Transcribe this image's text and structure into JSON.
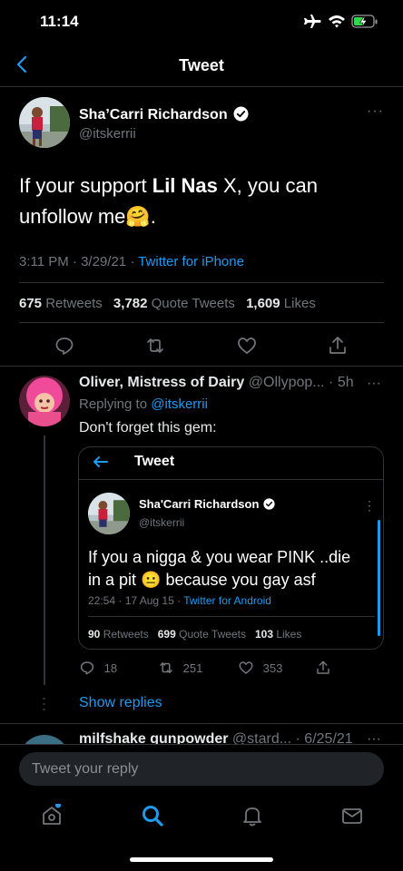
{
  "status_bar": {
    "time": "11:14"
  },
  "nav": {
    "title": "Tweet"
  },
  "tweet": {
    "name": "Sha’Carri Richardson",
    "handle": "@itskerrii",
    "more": "···",
    "text_prefix": "If your support ",
    "text_bold": "Lil Nas",
    "text_suffix": " X, you can unfollow me",
    "emoji": "🤗",
    "period": ".",
    "time": "3:11 PM",
    "date": "3/29/21",
    "sep": "·",
    "source": "Twitter for iPhone",
    "retweets": "675",
    "retweets_label": "Retweets",
    "quotes": "3,782",
    "quotes_label": "Quote Tweets",
    "likes": "1,609",
    "likes_label": "Likes"
  },
  "reply": {
    "name": "Oliver, Mistress of Dairy",
    "handle": "@Ollypop...",
    "age": "· 5h",
    "more": "···",
    "replying_prefix": "Replying to ",
    "replying_handle": "@itskerrii",
    "text": "Don't forget this gem:",
    "replies": "18",
    "retweets": "251",
    "likes": "353"
  },
  "quote": {
    "header": "Tweet",
    "name": "Sha'Carri Richardson",
    "handle": "@itskerrii",
    "more": "⋮",
    "text_line1": "If you a nigga & you wear PINK ..die",
    "text_line2_a": "in a pit ",
    "emoji": "😐",
    "text_line2_b": " because you gay asf",
    "meta": "22:54 · 17 Aug 15 · ",
    "source": "Twitter for Android",
    "retweets": "90",
    "retweets_label": "Retweets",
    "quotes": "699",
    "quotes_label": "Quote Tweets",
    "likes": "103",
    "likes_label": "Likes"
  },
  "show_replies": "Show replies",
  "next_reply": {
    "name": "milfshake gunpowder",
    "handle": "@stard...",
    "date": "· 6/25/21",
    "more": "···"
  },
  "reply_bar": {
    "placeholder": "Tweet your reply"
  },
  "colors": {
    "accent": "#1d9bf0",
    "background": "#000000",
    "muted": "#71767b",
    "divider": "#2f3336",
    "verified": "#ffffff"
  }
}
